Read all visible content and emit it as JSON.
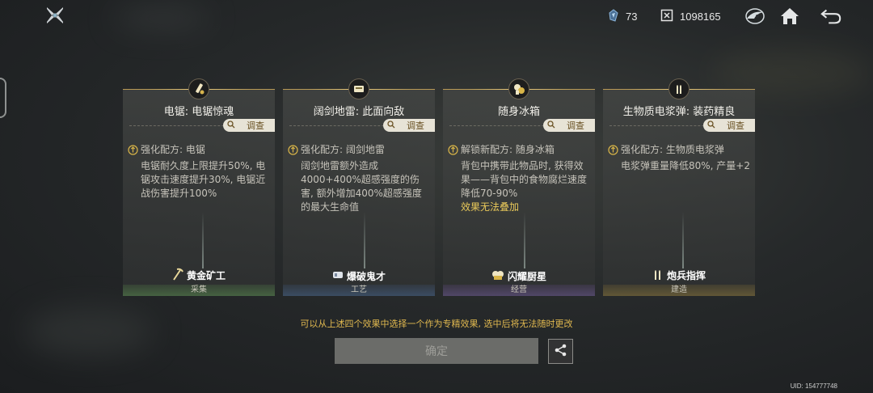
{
  "colors": {
    "accent_gold": "#e0b84f",
    "card_border": "#b99a56",
    "investigate_bg": "#e7e3d6"
  },
  "topbar": {
    "stat1": {
      "icon": "crystal-icon",
      "value": "73"
    },
    "stat2": {
      "icon": "coin-box-icon",
      "value": "1098165"
    },
    "icons": [
      "game-logo-icon",
      "wing-emblem-icon",
      "home-icon",
      "back-icon"
    ]
  },
  "cards": [
    {
      "title": "电锯: 电锯惊魂",
      "investigate": "调查",
      "head": "强化配方: 电锯",
      "desc": "电锯耐久度上限提升50%, 电锯攻击速度提升30%, 电锯近战伤害提升100%",
      "warn": "",
      "profession": "黄金矿工",
      "category": "采集"
    },
    {
      "title": "阔剑地雷: 此面向敌",
      "investigate": "调查",
      "head": "强化配方: 阔剑地雷",
      "desc": "阔剑地雷额外造成4000+400%超感强度的伤害, 额外增加400%超感强度的最大生命值",
      "warn": "",
      "profession": "爆破鬼才",
      "category": "工艺"
    },
    {
      "title": "随身冰箱",
      "investigate": "调查",
      "head": "解锁新配方: 随身冰箱",
      "desc": "背包中携带此物品时, 获得效果——背包中的食物腐烂速度降低70-90%",
      "warn": "效果无法叠加",
      "profession": "闪耀厨星",
      "category": "经营"
    },
    {
      "title": "生物质电浆弹: 装药精良",
      "investigate": "调查",
      "head": "强化配方: 生物质电浆弹",
      "desc": "电浆弹重量降低80%, 产量+2",
      "warn": "",
      "profession": "炮兵指挥",
      "category": "建造"
    }
  ],
  "hint": "可以从上述四个效果中选择一个作为专精效果, 选中后将无法随时更改",
  "confirm_label": "确定",
  "uid": "UID: 154777748"
}
